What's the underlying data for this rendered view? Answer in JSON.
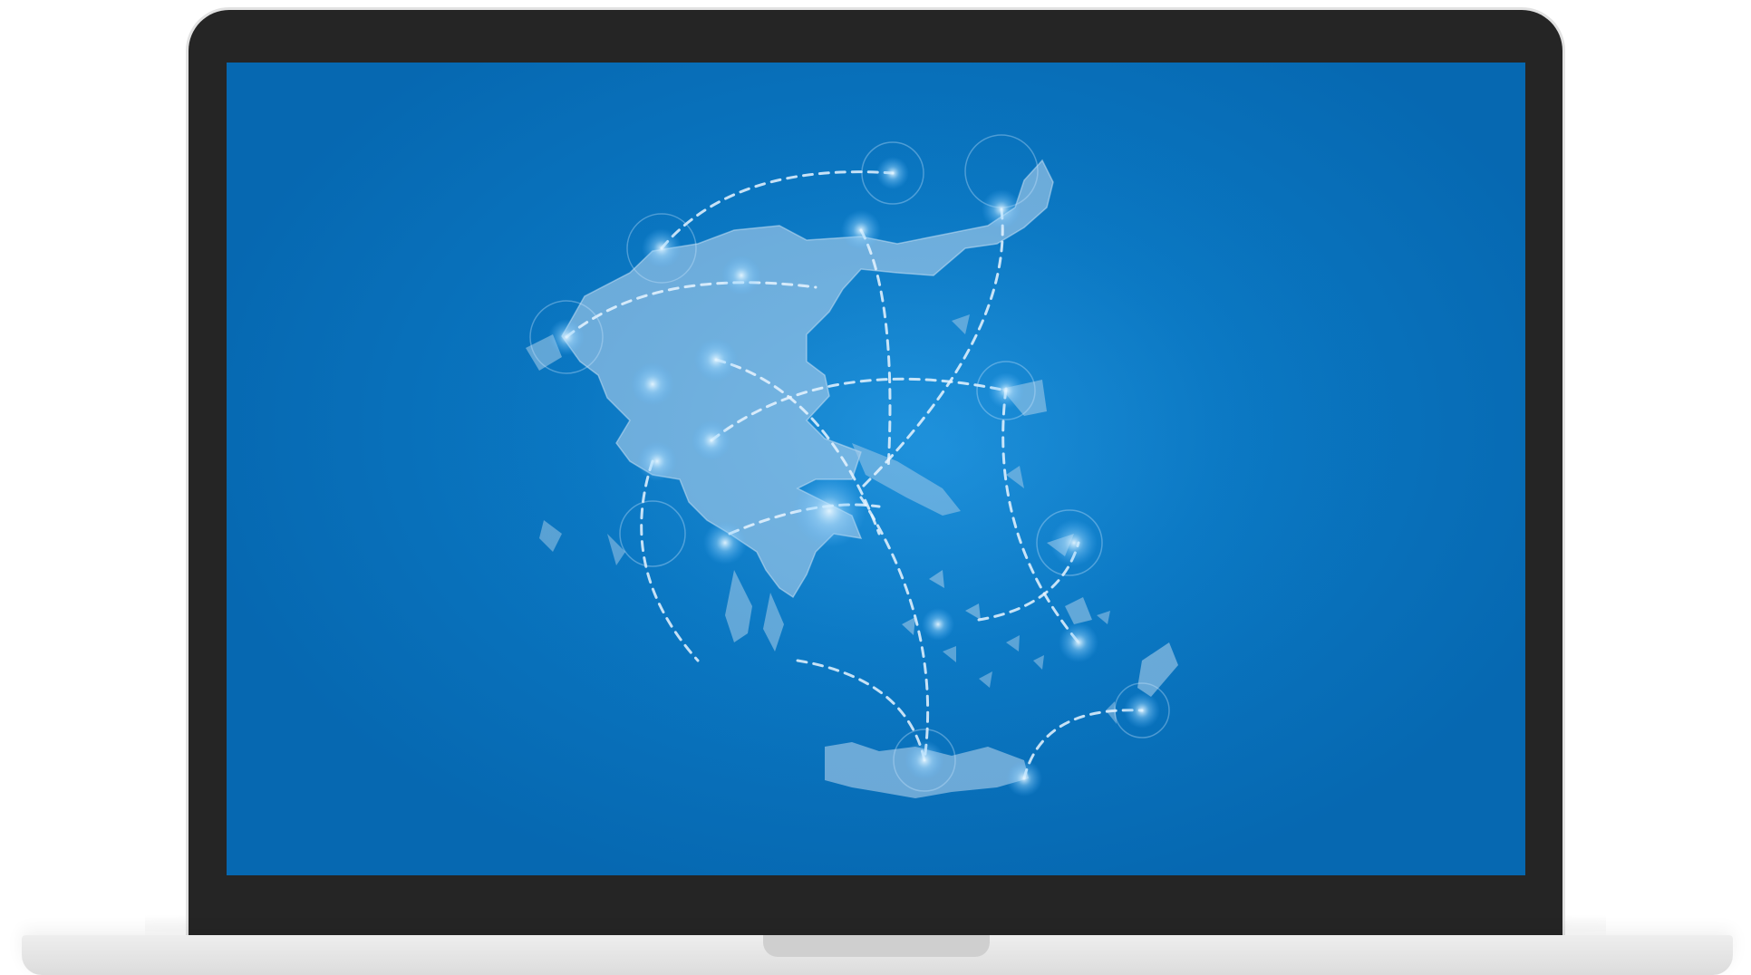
{
  "device": {
    "type": "laptop",
    "colors": {
      "bezel": "#252525",
      "frame": "#e2e2e2",
      "deck": "#e6e6e6",
      "screen_bg": "#0a77c2",
      "land": "#a9cdea",
      "route": "#e8f4ff",
      "glow": "#bfe6ff"
    }
  },
  "screen": {
    "illustration": "map-of-greece-with-dashed-route-lines"
  }
}
